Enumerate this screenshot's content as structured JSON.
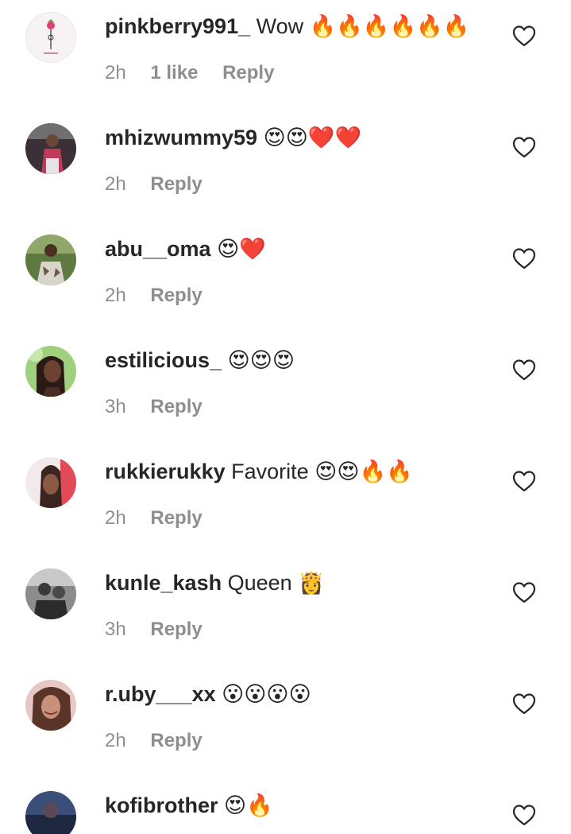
{
  "comments": [
    {
      "username": "pinkberry991_",
      "text": "Wow",
      "emoji": "🔥🔥🔥🔥🔥🔥",
      "time": "2h",
      "likes": "1 like",
      "reply": "Reply",
      "avatar_colors": [
        "#f7f3f5",
        "#e0407a"
      ]
    },
    {
      "username": "mhizwummy59",
      "text": "",
      "emoji": "😍😍❤️❤️",
      "time": "2h",
      "likes": "",
      "reply": "Reply",
      "avatar_colors": [
        "#3b3038",
        "#c03a5a"
      ]
    },
    {
      "username": "abu__oma",
      "text": "",
      "emoji": "😍❤️",
      "time": "2h",
      "likes": "",
      "reply": "Reply",
      "avatar_colors": [
        "#5f7a40",
        "#d9d4cc"
      ]
    },
    {
      "username": "estilicious_",
      "text": "",
      "emoji": "😍😍😍",
      "time": "3h",
      "likes": "",
      "reply": "Reply",
      "avatar_colors": [
        "#9fd07e",
        "#4a2e24"
      ]
    },
    {
      "username": "rukkierukky",
      "text": "Favorite",
      "emoji": "😍😍🔥🔥",
      "time": "2h",
      "likes": "",
      "reply": "Reply",
      "avatar_colors": [
        "#e34a57",
        "#3a2520"
      ]
    },
    {
      "username": "kunle_kash",
      "text": "Queen",
      "emoji": "👸",
      "time": "3h",
      "likes": "",
      "reply": "Reply",
      "avatar_colors": [
        "#8c8c8c",
        "#2b2b2b"
      ]
    },
    {
      "username": "r.uby___xx",
      "text": "",
      "emoji": "😮😮😮😮",
      "time": "2h",
      "likes": "",
      "reply": "Reply",
      "avatar_colors": [
        "#e7c9c4",
        "#5a3428"
      ]
    },
    {
      "username": "kofibrother",
      "text": "",
      "emoji": "😍🔥",
      "time": "",
      "likes": "",
      "reply": "",
      "avatar_colors": [
        "#3b4e7a",
        "#1e2740"
      ]
    }
  ],
  "colors": {
    "username": "#262626",
    "meta": "#8e8e8e",
    "background": "#ffffff"
  },
  "icons": {
    "like": "heart-outline-icon"
  }
}
